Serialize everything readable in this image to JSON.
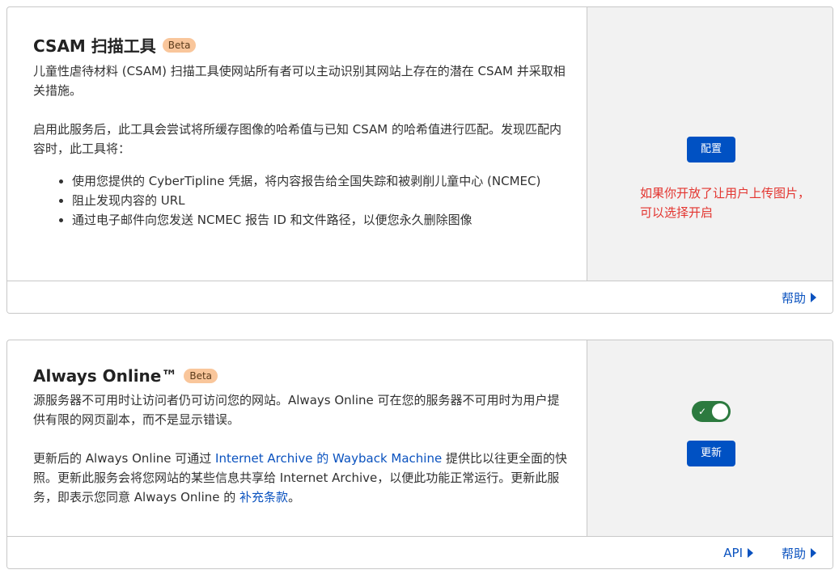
{
  "csam": {
    "title": "CSAM 扫描工具",
    "badge": "Beta",
    "desc": "儿童性虐待材料 (CSAM) 扫描工具使网站所有者可以主动识别其网站上存在的潜在 CSAM 并采取相关措施。",
    "intro": "启用此服务后，此工具会尝试将所缓存图像的哈希值与已知 CSAM 的哈希值进行匹配。发现匹配内容时，此工具将：",
    "bullets": [
      "使用您提供的 CyberTipline 凭据，将内容报告给全国失踪和被剥削儿童中心 (NCMEC)",
      "阻止发现内容的 URL",
      "通过电子邮件向您发送 NCMEC 报告 ID 和文件路径，以便您永久删除图像"
    ],
    "configure_label": "配置",
    "annotation": "如果你开放了让用户上传图片，可以选择开启",
    "help_label": "帮助"
  },
  "always_online": {
    "title": "Always Online™",
    "badge": "Beta",
    "desc": "源服务器不可用时让访问者仍可访问您的网站。Always Online 可在您的服务器不可用时为用户提供有限的网页副本，而不是显示错误。",
    "update_p1": "更新后的 Always Online 可通过 ",
    "update_link": "Internet Archive 的 Wayback Machine",
    "update_p2": " 提供比以往更全面的快照。更新此服务会将您网站的某些信息共享给 Internet Archive，以便此功能正常运行。更新此服务，即表示您同意 Always Online 的 ",
    "terms_link": "补充条款",
    "update_p3": "。",
    "toggle_on": true,
    "update_label": "更新",
    "api_label": "API",
    "help_label": "帮助"
  },
  "colors": {
    "primary_button": "#0051c3",
    "link": "#0a52bf",
    "toggle_on": "#2c7a3f",
    "annotation": "#e3342f",
    "badge": "#f9c69b"
  }
}
